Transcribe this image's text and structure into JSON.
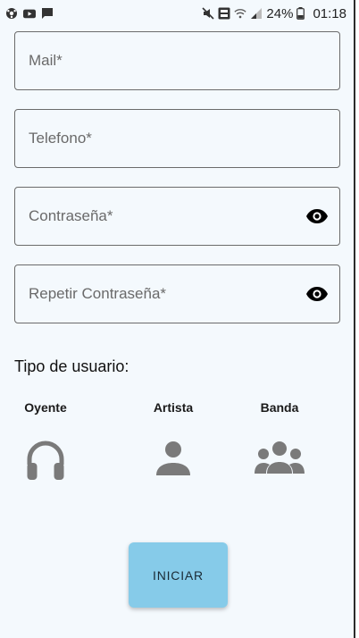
{
  "status_bar": {
    "battery": "24%",
    "time": "01:18",
    "left_icons": [
      "soccer-ball-icon",
      "youtube-icon",
      "message-icon"
    ],
    "right_icons": [
      "mute-icon",
      "volte-icon",
      "wifi-icon",
      "signal-icon",
      "battery-icon"
    ]
  },
  "form": {
    "mail_label": "Mail*",
    "phone_label": "Telefono*",
    "password_label": "Contraseña*",
    "repeat_password_label": "Repetir Contraseña*"
  },
  "user_type": {
    "title": "Tipo de usuario:",
    "options": [
      {
        "label": "Oyente",
        "icon": "headphones-icon"
      },
      {
        "label": "Artista",
        "icon": "person-icon"
      },
      {
        "label": "Banda",
        "icon": "group-icon"
      }
    ]
  },
  "actions": {
    "start_label": "INICIAR"
  },
  "colors": {
    "background": "#f4f9fd",
    "button": "#86cbe9",
    "icon_gray": "#7a7a7a"
  }
}
